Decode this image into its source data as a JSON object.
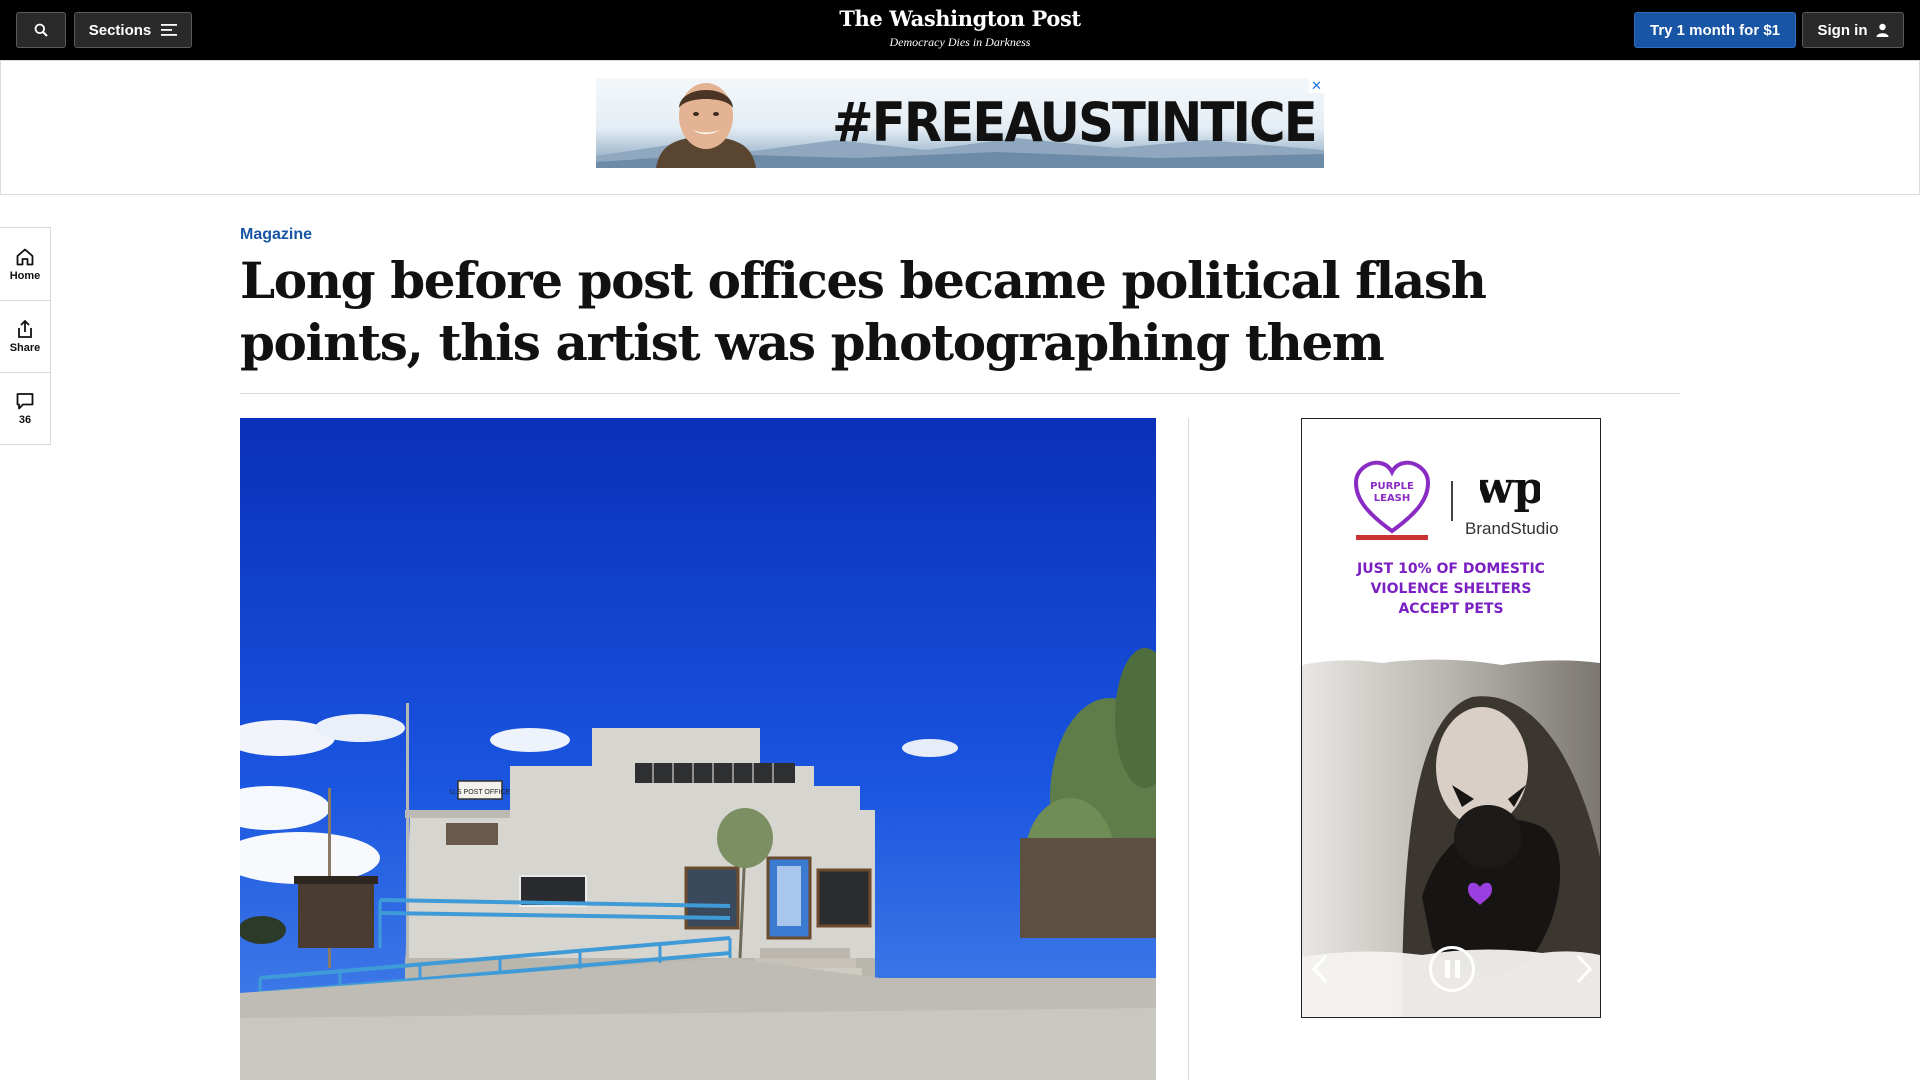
{
  "header": {
    "sections_label": "Sections",
    "brand_name": "The Washington Post",
    "brand_tagline": "Democracy Dies in Darkness",
    "subscribe_label": "Try 1 month for $1",
    "signin_label": "Sign in"
  },
  "top_ad": {
    "text": "#FREEAUSTINTICE",
    "close_glyph": "✕"
  },
  "rail": {
    "items": [
      {
        "label": "Home",
        "icon": "home-icon"
      },
      {
        "label": "Share",
        "icon": "share-icon"
      },
      {
        "label": "36",
        "icon": "comment-icon"
      }
    ]
  },
  "article": {
    "kicker": "Magazine",
    "headline": "Long before post offices became political flash points, this artist was photographing them",
    "photo_sign": "U.S POST OFFICE"
  },
  "side_ad": {
    "logo_text": "PURPLE LEASH",
    "brandstudio": "BrandStudio",
    "headline_lines": [
      "JUST 10% OF DOMESTIC",
      "VIOLENCE SHELTERS",
      "ACCEPT PETS"
    ]
  },
  "colors": {
    "accent_blue": "#1955a5",
    "ad_purple": "#7a1fc1",
    "sky_blue": "#0a35c9"
  }
}
